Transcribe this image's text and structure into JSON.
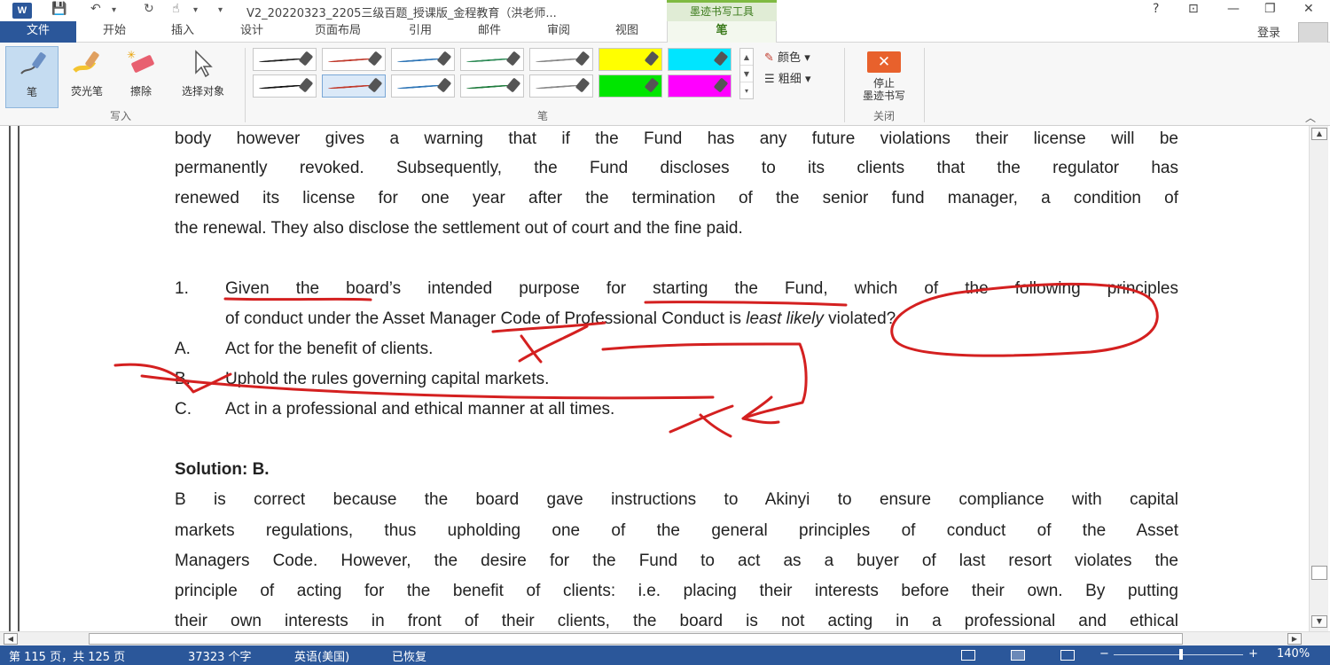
{
  "titlebar": {
    "app_icon": "W",
    "qat_save": "💾",
    "qat_undo": "↶",
    "qat_redo": "↻",
    "qat_touch": "☝",
    "qat_more": "▾",
    "doc_title": "V2_20220323_2205三级百题_授课版_金程教育（洪老师...",
    "context_tab": "墨迹书写工具",
    "help": "?",
    "ribbon_options": "⊡",
    "minimize": "—",
    "restore": "❐",
    "close": "✕"
  },
  "tabs": [
    {
      "label": "文件"
    },
    {
      "label": "开始"
    },
    {
      "label": "插入"
    },
    {
      "label": "设计"
    },
    {
      "label": "页面布局"
    },
    {
      "label": "引用"
    },
    {
      "label": "邮件"
    },
    {
      "label": "审阅"
    },
    {
      "label": "视图"
    },
    {
      "label": "笔"
    }
  ],
  "account": {
    "login": "登录"
  },
  "ribbon": {
    "write_group": {
      "label": "写入",
      "pen": "笔",
      "highlighter": "荧光笔",
      "eraser": "擦除",
      "select_objects": "选择对象"
    },
    "pens_group": {
      "label": "笔",
      "color": "颜色",
      "weight": "粗细",
      "pens": [
        {
          "color": "#222222",
          "kind": "pen"
        },
        {
          "color": "#c0392b",
          "kind": "pen"
        },
        {
          "color": "#2e75b6",
          "kind": "pen"
        },
        {
          "color": "#2e8b57",
          "kind": "pen"
        },
        {
          "color": "#888888",
          "kind": "pen"
        },
        {
          "color": "#ffff00",
          "kind": "highlighter"
        },
        {
          "color": "#00e5ff",
          "kind": "highlighter"
        },
        {
          "color": "#111111",
          "kind": "pen"
        },
        {
          "color": "#c0392b",
          "kind": "pen",
          "selected": true
        },
        {
          "color": "#2e75b6",
          "kind": "pen"
        },
        {
          "color": "#1e7b3c",
          "kind": "pen"
        },
        {
          "color": "#888888",
          "kind": "pen"
        },
        {
          "color": "#00e600",
          "kind": "highlighter"
        },
        {
          "color": "#ff00ff",
          "kind": "highlighter"
        }
      ]
    },
    "close_group": {
      "label": "关闭",
      "stop_line1": "停止",
      "stop_line2": "墨迹书写"
    }
  },
  "document": {
    "para1": [
      "body however gives a warning that if the Fund has any future violations their license will be",
      "permanently revoked. Subsequently, the Fund discloses to its clients that the regulator has",
      "renewed its license for one year after the termination of the senior fund manager, a condition of",
      "the renewal. They also disclose the settlement out of court and the fine paid."
    ],
    "question": {
      "number": "1.",
      "line1": "Given the board’s intended purpose for starting the Fund, which of the following principles",
      "line2_before": "of conduct under the Asset Manager Code of Professional Conduct is ",
      "line2_italic": "least likely",
      "line2_after": " violated?"
    },
    "options": [
      {
        "letter": "A.",
        "text": "Act for the benefit of clients."
      },
      {
        "letter": "B.",
        "text": "Uphold the rules governing capital markets."
      },
      {
        "letter": "C.",
        "text": "Act in a professional and ethical manner at all times."
      }
    ],
    "solution_heading": "Solution: B.",
    "solution": [
      "B is correct because the board gave instructions to Akinyi to ensure compliance with capital",
      "markets regulations, thus upholding one of the general principles of conduct of the Asset",
      "Managers Code. However, the desire for the Fund to act as a buyer of last resort violates the",
      "principle of acting for the benefit of clients: i.e. placing their interests before their own. By putting",
      "their own interests in front of their clients, the board is not acting in a professional and ethical"
    ],
    "ink_color": "#d42020"
  },
  "scrollbars": {
    "up": "▲",
    "down": "▼",
    "left": "◀",
    "right": "▶"
  },
  "statusbar": {
    "page": "第 115 页，共 125 页",
    "words": "37323 个字",
    "language": "英语(美国)",
    "state": "已恢复",
    "zoom_minus": "−",
    "zoom_plus": "+",
    "zoom": "140%"
  }
}
